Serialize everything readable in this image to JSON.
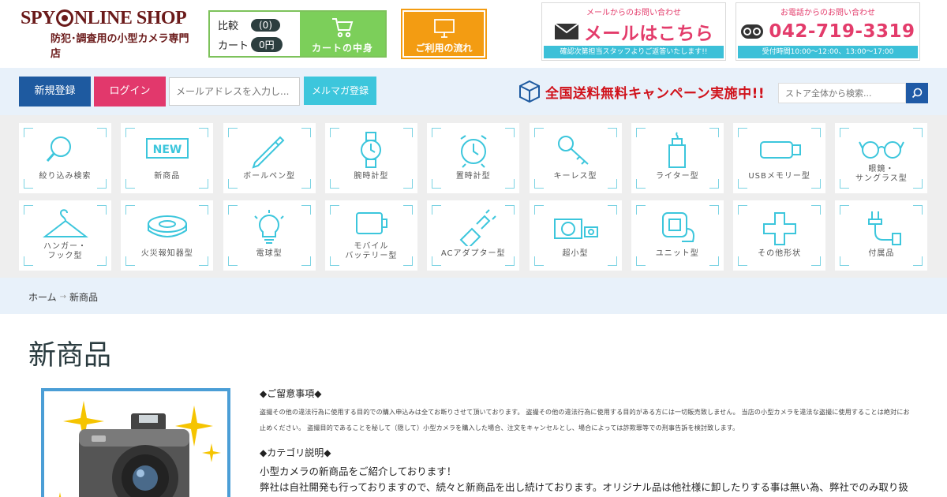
{
  "header": {
    "logo_main_left": "SPY",
    "logo_main_right": "NLINE SHOP",
    "logo_sub": "防犯･調査用の小型カメラ専門店",
    "compare_label": "比較",
    "compare_count": "(0)",
    "cart_label": "カート",
    "cart_amount": "0円",
    "cart_button": "カートの中身",
    "flow_button": "ご利用の流れ",
    "mail_caption": "メールからのお問い合わせ",
    "mail_main": "メールはこちら",
    "mail_bar": "確認次第担当スタッフよりご返答いたします!!",
    "phone_caption": "お電話からのお問い合わせ",
    "phone_number": "042-719-3319",
    "phone_bar": "受付時間10:00～12:00、13:00～17:00"
  },
  "nav": {
    "register": "新規登録",
    "login": "ログイン",
    "mail_placeholder": "メールアドレスを入力し...",
    "magazine": "メルマガ登録",
    "campaign": "全国送料無料キャンペーン実施中!!",
    "search_placeholder": "ストア全体から検索..."
  },
  "categories": [
    {
      "label": "絞り込み検索",
      "icon": "magnifier-icon"
    },
    {
      "label": "新商品",
      "icon": "new-badge-icon"
    },
    {
      "label": "ボールペン型",
      "icon": "pen-icon"
    },
    {
      "label": "腕時計型",
      "icon": "wristwatch-icon"
    },
    {
      "label": "置時計型",
      "icon": "alarm-clock-icon"
    },
    {
      "label": "キーレス型",
      "icon": "key-icon"
    },
    {
      "label": "ライター型",
      "icon": "lighter-icon"
    },
    {
      "label": "USBメモリー型",
      "icon": "usb-icon"
    },
    {
      "label": "眼鏡・\nサングラス型",
      "icon": "glasses-icon"
    },
    {
      "label": "ハンガー・\nフック型",
      "icon": "hanger-icon"
    },
    {
      "label": "火災報知器型",
      "icon": "smoke-detector-icon"
    },
    {
      "label": "電球型",
      "icon": "bulb-icon"
    },
    {
      "label": "モバイル\nバッテリー型",
      "icon": "battery-icon"
    },
    {
      "label": "ACアダプター型",
      "icon": "plug-icon"
    },
    {
      "label": "超小型",
      "icon": "mini-camera-icon"
    },
    {
      "label": "ユニット型",
      "icon": "unit-icon"
    },
    {
      "label": "その他形状",
      "icon": "plus-icon"
    },
    {
      "label": "付属品",
      "icon": "cable-icon"
    }
  ],
  "breadcrumb": {
    "home": "ホーム",
    "arrow": "→",
    "current": "新商品"
  },
  "page": {
    "title": "新商品",
    "notice_heading": "◆ご留意事項◆",
    "notice_text": "盗撮その他の違法行為に使用する目的での購入申込みは全てお断りさせて頂いております。 盗撮その他の違法行為に使用する目的がある方には一切販売致しません。 当店の小型カメラを違法な盗撮に使用することは絶対にお止めください。 盗撮目的であることを秘して（隠して）小型カメラを購入した場合、注文をキャンセルとし、場合によっては詐欺罪等での刑事告訴を検討致します。",
    "category_heading": "◆カテゴリ説明◆",
    "category_line1": "小型カメラの新商品をご紹介しております！",
    "category_line2": "弊社は自社開発も行っておりますので、続々と新商品を出し続けております。オリジナル品は他社様に卸したりする事は無い為、弊社でのみ取り扱っている物が多数当社にはあります！"
  },
  "colors": {
    "brand": "#6b1a1a",
    "accent_cyan": "#3cc6dc",
    "register_blue": "#1e5aa0",
    "login_pink": "#e2386c",
    "cart_green": "#7ccf5a",
    "flow_orange": "#f39c12",
    "campaign_red": "#d0121b"
  }
}
